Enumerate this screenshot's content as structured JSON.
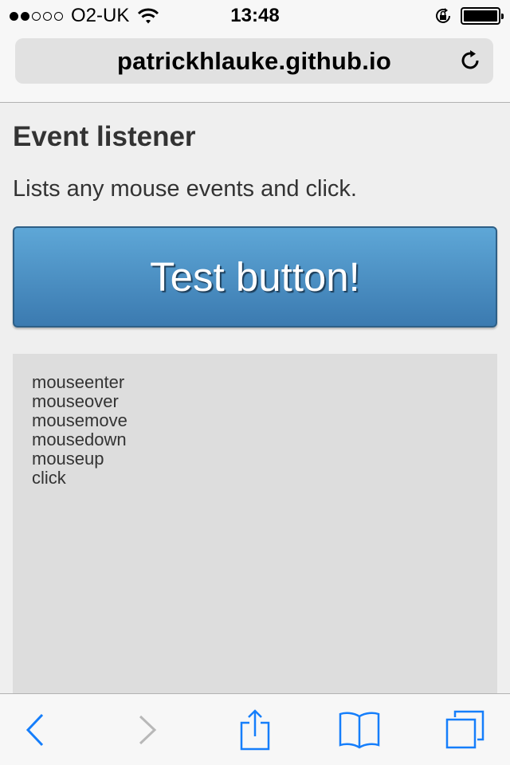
{
  "status_bar": {
    "carrier": "O2-UK",
    "time": "13:48",
    "signal_bars_filled": 2,
    "signal_bars_total": 5,
    "battery_level": 1.0
  },
  "browser": {
    "url": "patrickhlauke.github.io",
    "icons": {
      "reload": "reload-icon",
      "back": "back-icon",
      "forward": "forward-icon",
      "share": "share-icon",
      "bookmarks": "bookmarks-icon",
      "tabs": "tabs-icon",
      "wifi": "wifi-icon",
      "lock": "rotation-lock-icon"
    }
  },
  "page": {
    "title": "Event listener",
    "description": "Lists any mouse events and click.",
    "button_label": "Test button!",
    "events": [
      "mouseenter",
      "mouseover",
      "mousemove",
      "mousedown",
      "mouseup",
      "click"
    ]
  },
  "colors": {
    "button_top": "#5ea7d7",
    "button_bottom": "#3b7ab0",
    "ios_blue": "#157efb",
    "disabled_gray": "#b8b8b8",
    "panel_bg": "#dddddd"
  }
}
